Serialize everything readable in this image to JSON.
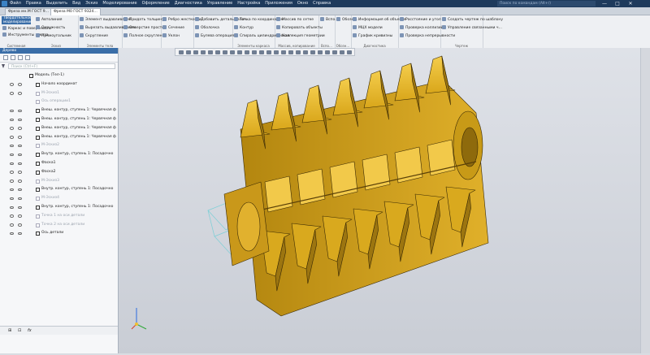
{
  "titlebar": {
    "menu": [
      "Файл",
      "Правка",
      "Выделить",
      "Вид",
      "Эскиз",
      "Моделирование",
      "Оформление",
      "Диагностика",
      "Управление",
      "Настройка",
      "Приложения",
      "Окно",
      "Справка"
    ],
    "search_placeholder": "Поиск по командам (Alt+/)",
    "buttons": [
      "—",
      "□",
      "✕"
    ]
  },
  "tabs": [
    "Фреза мн.М ГОСТ 9…",
    "Фреза М0 ГОСТ 9324…"
  ],
  "ribbon": {
    "solid_tab": "Твердотельное моделирование",
    "left_items": [
      "Каркас и поверхности",
      "Инструменты эскиза"
    ],
    "groups": [
      {
        "items": [
          "Автолиния",
          "Окружность",
          "Прямоугольник"
        ],
        "caption": "Эскиз"
      },
      {
        "items": [
          "Элемент выдавливания",
          "Вырезать выдавливанием",
          "Скругление"
        ],
        "caption": "Элементы тела"
      },
      {
        "items": [
          "Придать толщину",
          "Отверстие простое",
          "Полное скругление"
        ],
        "caption": ""
      },
      {
        "items": [
          "Ребро жесткости",
          "Сечение",
          "Уклон"
        ],
        "caption": ""
      },
      {
        "items": [
          "Добавить деталь-загот…",
          "Оболочка",
          "Булева операция"
        ],
        "caption": ""
      },
      {
        "items": [
          "Точка по координатам",
          "Контур",
          "Спираль цилиндрическая"
        ],
        "caption": "Элементы каркаса"
      },
      {
        "items": [
          "Массив по сетке",
          "Копировать объекты",
          "Коллекция геометрии"
        ],
        "caption": "Массив, копирование"
      },
      {
        "items": [
          "Вспо…"
        ],
        "caption": "Вспо…"
      },
      {
        "items": [
          "Обозн…"
        ],
        "caption": "Обозн…"
      },
      {
        "items": [
          "Информация об объекте",
          "МЦХ модели",
          "График кривизны"
        ],
        "caption": "Диагностика"
      },
      {
        "items": [
          "Расстояние и угол",
          "Проверка коллизий",
          "Проверка непрерывности"
        ],
        "caption": ""
      },
      {
        "items": [
          "Создать чертеж по шаблону",
          "Управление связанными ч…"
        ],
        "caption": "Чертеж"
      }
    ],
    "compile_label": "Системная",
    "view_label": "Вид"
  },
  "panel": {
    "title": "Дерево",
    "search_placeholder": "Поиск (Ctrl+F)",
    "tree": [
      {
        "label": "Модель (Тел-1)",
        "dim": false,
        "eye": false,
        "indent": 36
      },
      {
        "label": "Начало координат",
        "dim": false,
        "eye": true,
        "indent": 44
      },
      {
        "label": "М-Эскиз1",
        "dim": true,
        "eye": true,
        "indent": 44
      },
      {
        "label": "Ось операции1",
        "dim": true,
        "eye": false,
        "indent": 44
      },
      {
        "label": "Внеш. контур, ступень 1: Червячная ф",
        "dim": false,
        "eye": true,
        "indent": 44
      },
      {
        "label": "Внеш. контур, ступень 1: Червячная ф",
        "dim": false,
        "eye": true,
        "indent": 44
      },
      {
        "label": "Внеш. контур, ступень 1: Червячная ф",
        "dim": false,
        "eye": true,
        "indent": 44
      },
      {
        "label": "Внеш. контур, ступень 1: Червячная ф",
        "dim": false,
        "eye": true,
        "indent": 44
      },
      {
        "label": "М-Эскиз2",
        "dim": true,
        "eye": true,
        "indent": 44
      },
      {
        "label": "Внутр. контур, ступень 1: Посадочно",
        "dim": false,
        "eye": true,
        "indent": 44
      },
      {
        "label": "Фаска1",
        "dim": false,
        "eye": true,
        "indent": 44
      },
      {
        "label": "Фаска2",
        "dim": false,
        "eye": true,
        "indent": 44
      },
      {
        "label": "М-Эскиз3",
        "dim": true,
        "eye": true,
        "indent": 44
      },
      {
        "label": "Внутр. контур, ступень 1: Посадочно",
        "dim": false,
        "eye": true,
        "indent": 44
      },
      {
        "label": "М-Эскиз4",
        "dim": true,
        "eye": true,
        "indent": 44
      },
      {
        "label": "Внутр. контур, ступень 1: Посадочно",
        "dim": false,
        "eye": true,
        "indent": 44
      },
      {
        "label": "Точка 1 на оси детали",
        "dim": true,
        "eye": true,
        "indent": 44
      },
      {
        "label": "Точка 2 на оси детали",
        "dim": true,
        "eye": true,
        "indent": 44
      },
      {
        "label": "Ось детали",
        "dim": false,
        "eye": true,
        "indent": 44
      }
    ],
    "bottom_tabs": [
      "⊞",
      "⊡",
      "fx"
    ]
  },
  "colors": {
    "part_fill": "#d9a91e",
    "part_dark": "#9c7510",
    "part_light": "#f2c94a",
    "edge": "#3a2a05",
    "accent": "#3a6ea8"
  }
}
